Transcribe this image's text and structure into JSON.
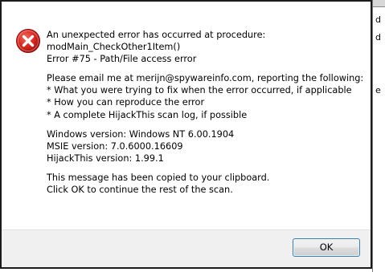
{
  "dialog": {
    "message_lines": [
      "An unexpected error has occurred at procedure:",
      "modMain_CheckOther1Item()",
      "Error #75 - Path/File access error",
      "",
      "Please email me at merijn@spywareinfo.com, reporting the following:",
      "* What you were trying to fix when the error occurred, if applicable",
      "* How you can reproduce the error",
      "* A complete HijackThis scan log, if possible",
      "",
      "Windows version: Windows NT 6.00.1904",
      "MSIE version: 7.0.6000.16609",
      "HijackThis version: 1.99.1",
      "",
      "This message has been copied to your clipboard.",
      "Click OK to continue the rest of the scan."
    ],
    "icon": "error-icon",
    "ok_label": "OK"
  },
  "background_window": {
    "edge_chars": [
      "d",
      "d",
      "e"
    ]
  },
  "colors": {
    "icon_red": "#d8261f",
    "button_border": "#3c7fb1",
    "footer_bg": "#f0f0f0"
  }
}
